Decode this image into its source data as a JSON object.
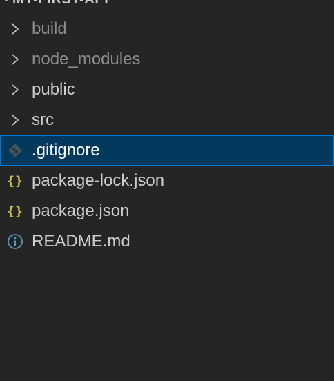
{
  "explorer": {
    "section_title": "MY-FIRST-APP",
    "header_actions": [
      {
        "name": "new-file-icon"
      },
      {
        "name": "new-folder-icon"
      },
      {
        "name": "refresh-icon"
      },
      {
        "name": "collapse-all-icon"
      }
    ],
    "items": [
      {
        "label": "build",
        "kind": "folder",
        "state": "muted",
        "icon": "chevron-right-icon"
      },
      {
        "label": "node_modules",
        "kind": "folder",
        "state": "muted",
        "icon": "chevron-right-icon"
      },
      {
        "label": "public",
        "kind": "folder",
        "state": "normal",
        "icon": "chevron-right-icon"
      },
      {
        "label": "src",
        "kind": "folder",
        "state": "normal",
        "icon": "chevron-right-icon"
      },
      {
        "label": ".gitignore",
        "kind": "file",
        "state": "selected",
        "icon": "git-icon"
      },
      {
        "label": "package-lock.json",
        "kind": "file",
        "state": "normal",
        "icon": "json-icon",
        "icon_text": "{}"
      },
      {
        "label": "package.json",
        "kind": "file",
        "state": "normal",
        "icon": "json-icon",
        "icon_text": "{}"
      },
      {
        "label": "README.md",
        "kind": "file",
        "state": "normal",
        "icon": "info-icon"
      }
    ],
    "colors": {
      "background": "#252526",
      "selection": "#04395e",
      "selection_border": "#0078d4",
      "json_icon": "#cbcb41",
      "info_icon": "#519aba",
      "git_icon": "#41535b"
    }
  }
}
